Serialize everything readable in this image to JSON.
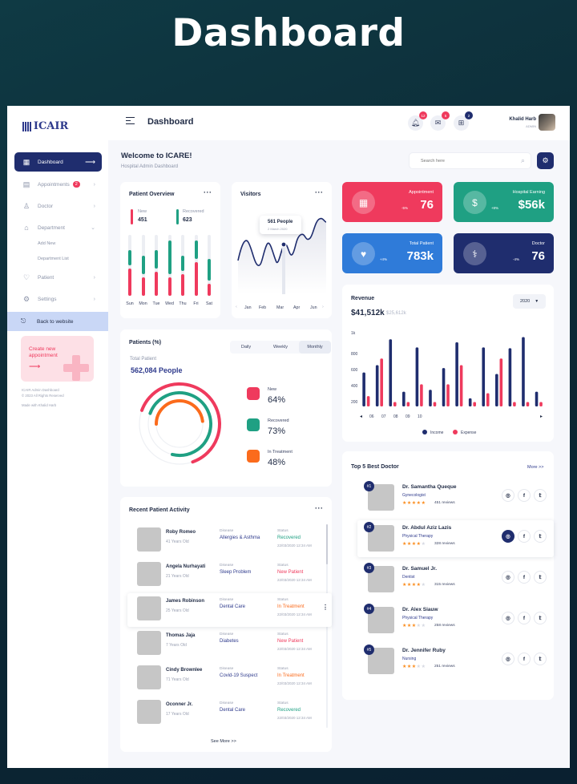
{
  "hero_title": "Dashboard",
  "brand": "ICAIR",
  "colors": {
    "navy": "#1f2d6e",
    "red": "#ef3a5d",
    "teal": "#1fa083",
    "blue": "#2f7bd9",
    "orange": "#fb6b1c"
  },
  "sidebar": {
    "items": [
      {
        "label": "Dashboard",
        "icon": "grid-icon"
      },
      {
        "label": "Appointments",
        "icon": "calendar-icon",
        "badge": "2"
      },
      {
        "label": "Doctor",
        "icon": "doctor-icon"
      },
      {
        "label": "Department",
        "icon": "home-icon"
      },
      {
        "label": "Patient",
        "icon": "heart-icon"
      },
      {
        "label": "Settings",
        "icon": "gear-icon"
      }
    ],
    "sub_items": [
      "Add New",
      "Department List"
    ],
    "back_label": "Back to website",
    "promo_text": "Create new appointment",
    "footer": [
      "ICAIR Admin Dashboard",
      "© 2023 All Rights Reserved",
      "Made with Khalid Harb"
    ]
  },
  "topbar": {
    "title": "Dashboard",
    "notif_count": "12",
    "message_count": "5",
    "gift_count": "2",
    "user_name": "Khalid Harb",
    "user_role": "ADMIN"
  },
  "welcome": {
    "title": "Welcome to ICARE!",
    "subtitle": "Hospital Admin Dashboard"
  },
  "search": {
    "placeholder": "Search here"
  },
  "patient_overview": {
    "title": "Patient Overview",
    "new_label": "New",
    "new_value": "451",
    "rec_label": "Recovered",
    "rec_value": "623",
    "days": [
      "Sun",
      "Mon",
      "Tue",
      "Wed",
      "Thu",
      "Fri",
      "Sat"
    ],
    "bars": [
      {
        "red": 0.45,
        "teal": 0.25
      },
      {
        "red": 0.3,
        "teal": 0.3
      },
      {
        "red": 0.4,
        "teal": 0.3
      },
      {
        "red": 0.3,
        "teal": 0.55
      },
      {
        "red": 0.35,
        "teal": 0.25
      },
      {
        "red": 0.55,
        "teal": 0.3
      },
      {
        "red": 0.2,
        "teal": 0.35
      }
    ]
  },
  "visitors": {
    "title": "Visitors",
    "tooltip_value": "561 People",
    "tooltip_date": "2 March 2020",
    "months": [
      "Jan",
      "Feb",
      "Mar",
      "Apr",
      "Jun"
    ]
  },
  "stats": [
    {
      "label": "Appointment",
      "value": "76",
      "trend": "-5%",
      "color": "#ef3a5d",
      "icon": "calendar-icon"
    },
    {
      "label": "Hospital Earning",
      "value": "$56k",
      "trend": "+8%",
      "color": "#1fa083",
      "icon": "dollar-icon"
    },
    {
      "label": "Total Patient",
      "value": "783k",
      "trend": "+4%",
      "color": "#2f7bd9",
      "icon": "heart-pulse-icon"
    },
    {
      "label": "Doctor",
      "value": "76",
      "trend": "-4%",
      "color": "#1f2d6e",
      "icon": "stethoscope-icon"
    }
  ],
  "revenue": {
    "title": "Revenue",
    "year": "2020",
    "income": "$41,512k",
    "expense": "$25,612k",
    "legend_income": "Income",
    "legend_expense": "Expense"
  },
  "chart_data": {
    "type": "bar",
    "x": [
      "06",
      "07",
      "08",
      "09",
      "10"
    ],
    "yticks": [
      "1k",
      "800",
      "600",
      "400",
      "200"
    ],
    "ylim": [
      0,
      1000
    ],
    "series": [
      {
        "name": "Income",
        "values": [
          460,
          560,
          910,
          200,
          800,
          225,
          520,
          870,
          110,
          800,
          440,
          790,
          940,
          200
        ]
      },
      {
        "name": "Expense",
        "values": [
          140,
          650,
          60,
          60,
          300,
          60,
          300,
          560,
          60,
          180,
          650,
          60,
          60,
          60
        ]
      }
    ]
  },
  "patients_pct": {
    "title": "Patients (%)",
    "tabs": [
      "Daily",
      "Weekly",
      "Monthly"
    ],
    "total_label": "Total Patient",
    "total_value": "562,084 People",
    "items": [
      {
        "label": "New",
        "value": "64%",
        "color": "#ef3a5d",
        "frac": 0.64
      },
      {
        "label": "Recovered",
        "value": "73%",
        "color": "#1fa083",
        "frac": 0.73
      },
      {
        "label": "In Treatment",
        "value": "48%",
        "color": "#fb6b1c",
        "frac": 0.48
      }
    ]
  },
  "activity": {
    "title": "Recent Patient Activity",
    "disease_label": "Disease",
    "status_label": "Status",
    "rows": [
      {
        "name": "Roby Romeo",
        "age": "41 Years Old",
        "disease": "Allergies & Asthma",
        "status": "Recovered",
        "scolor": "#1fa083",
        "date": "22/03/2020 12:34 AM"
      },
      {
        "name": "Angela Nurhayati",
        "age": "21 Years Old",
        "disease": "Sleep Problem",
        "status": "New Patient",
        "scolor": "#ef3a5d",
        "date": "22/03/2020 12:34 AM"
      },
      {
        "name": "James Robinson",
        "age": "25 Years Old",
        "disease": "Dental Care",
        "status": "In Treatment",
        "scolor": "#fb6b1c",
        "date": "22/03/2020 12:34 AM"
      },
      {
        "name": "Thomas Jaja",
        "age": "7 Years Old",
        "disease": "Diabetes",
        "status": "New Patient",
        "scolor": "#ef3a5d",
        "date": "22/03/2020 12:34 AM"
      },
      {
        "name": "Cindy Brownlee",
        "age": "71 Years Old",
        "disease": "Covid-19 Suspect",
        "status": "In Treatment",
        "scolor": "#fb6b1c",
        "date": "22/03/2020 12:34 AM"
      },
      {
        "name": "Oconner Jr.",
        "age": "17 Years Old",
        "disease": "Dental Care",
        "status": "Recovered",
        "scolor": "#1fa083",
        "date": "22/03/2020 12:34 AM"
      }
    ],
    "see_more": "See More >>"
  },
  "top_doctors": {
    "title": "Top 5 Best Doctor",
    "more": "More >>",
    "items": [
      {
        "rank": "#1",
        "name": "Dr. Samantha Queque",
        "spec": "Gynecologist",
        "stars": 5,
        "reviews": "451 reviews"
      },
      {
        "rank": "#2",
        "name": "Dr. Abdul Aziz Lazis",
        "spec": "Physical Therapy",
        "stars": 4,
        "reviews": "328 reviews"
      },
      {
        "rank": "#3",
        "name": "Dr. Samuel Jr.",
        "spec": "Dentist",
        "stars": 4,
        "reviews": "315 reviews"
      },
      {
        "rank": "#4",
        "name": "Dr. Alex Siauw",
        "spec": "Physical Therapy",
        "stars": 3,
        "reviews": "258 reviews"
      },
      {
        "rank": "#5",
        "name": "Dr. Jennifer Ruby",
        "spec": "Nursing",
        "stars": 3,
        "reviews": "251 reviews"
      }
    ]
  }
}
